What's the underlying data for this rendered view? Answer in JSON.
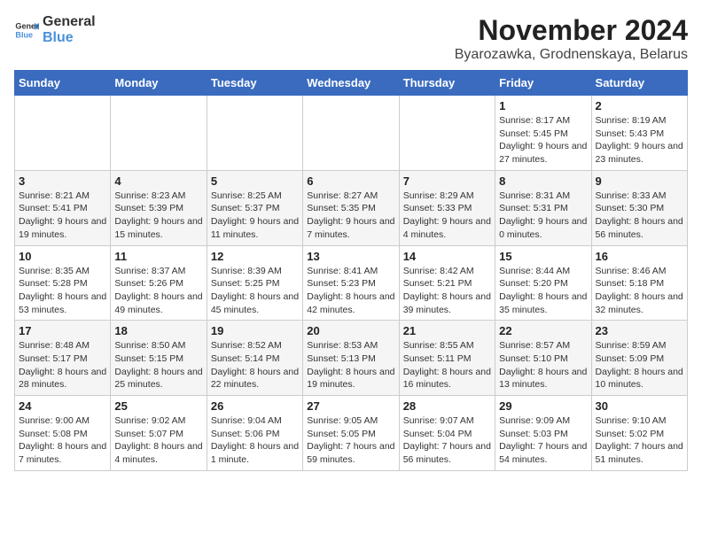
{
  "logo": {
    "text_general": "General",
    "text_blue": "Blue"
  },
  "title": "November 2024",
  "subtitle": "Byarozawka, Grodnenskaya, Belarus",
  "days_of_week": [
    "Sunday",
    "Monday",
    "Tuesday",
    "Wednesday",
    "Thursday",
    "Friday",
    "Saturday"
  ],
  "weeks": [
    [
      {
        "day": "",
        "info": ""
      },
      {
        "day": "",
        "info": ""
      },
      {
        "day": "",
        "info": ""
      },
      {
        "day": "",
        "info": ""
      },
      {
        "day": "",
        "info": ""
      },
      {
        "day": "1",
        "info": "Sunrise: 8:17 AM\nSunset: 5:45 PM\nDaylight: 9 hours and 27 minutes."
      },
      {
        "day": "2",
        "info": "Sunrise: 8:19 AM\nSunset: 5:43 PM\nDaylight: 9 hours and 23 minutes."
      }
    ],
    [
      {
        "day": "3",
        "info": "Sunrise: 8:21 AM\nSunset: 5:41 PM\nDaylight: 9 hours and 19 minutes."
      },
      {
        "day": "4",
        "info": "Sunrise: 8:23 AM\nSunset: 5:39 PM\nDaylight: 9 hours and 15 minutes."
      },
      {
        "day": "5",
        "info": "Sunrise: 8:25 AM\nSunset: 5:37 PM\nDaylight: 9 hours and 11 minutes."
      },
      {
        "day": "6",
        "info": "Sunrise: 8:27 AM\nSunset: 5:35 PM\nDaylight: 9 hours and 7 minutes."
      },
      {
        "day": "7",
        "info": "Sunrise: 8:29 AM\nSunset: 5:33 PM\nDaylight: 9 hours and 4 minutes."
      },
      {
        "day": "8",
        "info": "Sunrise: 8:31 AM\nSunset: 5:31 PM\nDaylight: 9 hours and 0 minutes."
      },
      {
        "day": "9",
        "info": "Sunrise: 8:33 AM\nSunset: 5:30 PM\nDaylight: 8 hours and 56 minutes."
      }
    ],
    [
      {
        "day": "10",
        "info": "Sunrise: 8:35 AM\nSunset: 5:28 PM\nDaylight: 8 hours and 53 minutes."
      },
      {
        "day": "11",
        "info": "Sunrise: 8:37 AM\nSunset: 5:26 PM\nDaylight: 8 hours and 49 minutes."
      },
      {
        "day": "12",
        "info": "Sunrise: 8:39 AM\nSunset: 5:25 PM\nDaylight: 8 hours and 45 minutes."
      },
      {
        "day": "13",
        "info": "Sunrise: 8:41 AM\nSunset: 5:23 PM\nDaylight: 8 hours and 42 minutes."
      },
      {
        "day": "14",
        "info": "Sunrise: 8:42 AM\nSunset: 5:21 PM\nDaylight: 8 hours and 39 minutes."
      },
      {
        "day": "15",
        "info": "Sunrise: 8:44 AM\nSunset: 5:20 PM\nDaylight: 8 hours and 35 minutes."
      },
      {
        "day": "16",
        "info": "Sunrise: 8:46 AM\nSunset: 5:18 PM\nDaylight: 8 hours and 32 minutes."
      }
    ],
    [
      {
        "day": "17",
        "info": "Sunrise: 8:48 AM\nSunset: 5:17 PM\nDaylight: 8 hours and 28 minutes."
      },
      {
        "day": "18",
        "info": "Sunrise: 8:50 AM\nSunset: 5:15 PM\nDaylight: 8 hours and 25 minutes."
      },
      {
        "day": "19",
        "info": "Sunrise: 8:52 AM\nSunset: 5:14 PM\nDaylight: 8 hours and 22 minutes."
      },
      {
        "day": "20",
        "info": "Sunrise: 8:53 AM\nSunset: 5:13 PM\nDaylight: 8 hours and 19 minutes."
      },
      {
        "day": "21",
        "info": "Sunrise: 8:55 AM\nSunset: 5:11 PM\nDaylight: 8 hours and 16 minutes."
      },
      {
        "day": "22",
        "info": "Sunrise: 8:57 AM\nSunset: 5:10 PM\nDaylight: 8 hours and 13 minutes."
      },
      {
        "day": "23",
        "info": "Sunrise: 8:59 AM\nSunset: 5:09 PM\nDaylight: 8 hours and 10 minutes."
      }
    ],
    [
      {
        "day": "24",
        "info": "Sunrise: 9:00 AM\nSunset: 5:08 PM\nDaylight: 8 hours and 7 minutes."
      },
      {
        "day": "25",
        "info": "Sunrise: 9:02 AM\nSunset: 5:07 PM\nDaylight: 8 hours and 4 minutes."
      },
      {
        "day": "26",
        "info": "Sunrise: 9:04 AM\nSunset: 5:06 PM\nDaylight: 8 hours and 1 minute."
      },
      {
        "day": "27",
        "info": "Sunrise: 9:05 AM\nSunset: 5:05 PM\nDaylight: 7 hours and 59 minutes."
      },
      {
        "day": "28",
        "info": "Sunrise: 9:07 AM\nSunset: 5:04 PM\nDaylight: 7 hours and 56 minutes."
      },
      {
        "day": "29",
        "info": "Sunrise: 9:09 AM\nSunset: 5:03 PM\nDaylight: 7 hours and 54 minutes."
      },
      {
        "day": "30",
        "info": "Sunrise: 9:10 AM\nSunset: 5:02 PM\nDaylight: 7 hours and 51 minutes."
      }
    ]
  ]
}
